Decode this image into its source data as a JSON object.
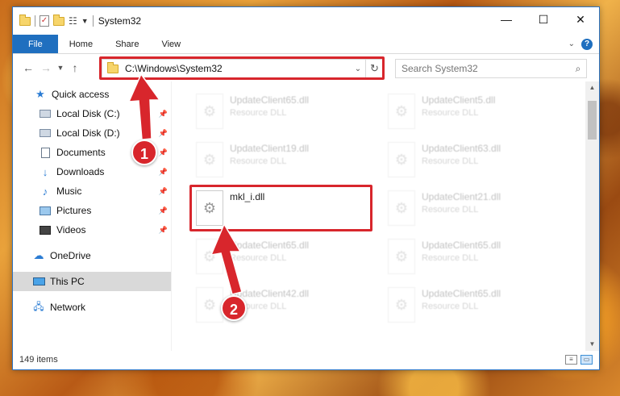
{
  "window": {
    "title": "System32",
    "controls": {
      "minimize": "—",
      "maximize": "☐",
      "close": "✕"
    }
  },
  "ribbon": {
    "tabs": [
      "File",
      "Home",
      "Share",
      "View"
    ]
  },
  "address": {
    "path": "C:\\Windows\\System32"
  },
  "search": {
    "placeholder": "Search System32"
  },
  "nav": {
    "items": [
      {
        "label": "Quick access",
        "icon": "star-icon"
      },
      {
        "label": "Local Disk (C:)",
        "icon": "disk-icon",
        "pinned": true
      },
      {
        "label": "Local Disk (D:)",
        "icon": "disk-icon",
        "pinned": true
      },
      {
        "label": "Documents",
        "icon": "documents-icon",
        "pinned": true
      },
      {
        "label": "Downloads",
        "icon": "downloads-icon",
        "pinned": true
      },
      {
        "label": "Music",
        "icon": "music-icon",
        "pinned": true
      },
      {
        "label": "Pictures",
        "icon": "pictures-icon",
        "pinned": true
      },
      {
        "label": "Videos",
        "icon": "videos-icon",
        "pinned": true
      },
      {
        "label": "OneDrive",
        "icon": "onedrive-icon"
      },
      {
        "label": "This PC",
        "icon": "this-pc-icon",
        "selected": true
      },
      {
        "label": "Network",
        "icon": "network-icon"
      }
    ]
  },
  "files": {
    "tiles": [
      {
        "name": "UpdateClient65.dll",
        "type": "Resource DLL"
      },
      {
        "name": "UpdateClient5.dll",
        "type": "Resource DLL"
      },
      {
        "name": "UpdateClient19.dll",
        "type": "Resource DLL"
      },
      {
        "name": "UpdateClient63.dll",
        "type": "Resource DLL"
      },
      {
        "name": "mkl_i.dll",
        "type": ""
      },
      {
        "name": "UpdateClient21.dll",
        "type": "Resource DLL"
      },
      {
        "name": "UpdateClient65.dll",
        "type": "Resource DLL"
      },
      {
        "name": "UpdateClient65.dll",
        "type": "Resource DLL"
      },
      {
        "name": "UpdateClient42.dll",
        "type": "Resource DLL"
      },
      {
        "name": "UpdateClient65.dll",
        "type": "Resource DLL"
      }
    ]
  },
  "status": {
    "item_count": "149 items"
  },
  "annotations": {
    "step1": "1",
    "step2": "2",
    "color": "#d8262c"
  }
}
